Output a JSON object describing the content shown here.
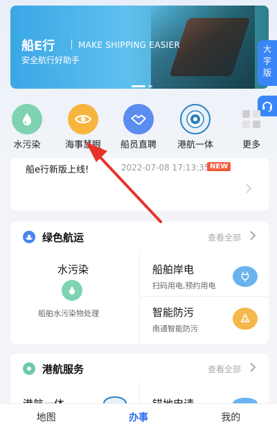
{
  "banner": {
    "title": "船E行",
    "slogan_en": "MAKE SHIPPING EASIER",
    "slogan_cn": "安全航行好助手"
  },
  "side_buttons": {
    "big_text": [
      "大",
      "字",
      "版"
    ]
  },
  "quick_actions": [
    {
      "label": "水污染",
      "icon": "water-drop-icon",
      "color": "#6cc9a6"
    },
    {
      "label": "海事慧眼",
      "icon": "eye-icon",
      "color": "#f7b540"
    },
    {
      "label": "船员直聘",
      "icon": "handshake-icon",
      "color": "#5b8cf0"
    },
    {
      "label": "港航一体",
      "icon": "seal-icon",
      "color": "#2a7fbf"
    },
    {
      "label": "更多",
      "icon": "grid-icon",
      "color": "#cccccc"
    }
  ],
  "news": {
    "title": "船e行新版上线!",
    "date": "2022-07-08 17:13:35",
    "badge": "NEW"
  },
  "green_shipping": {
    "title": "绿色航运",
    "view_all": "查看全部",
    "left": {
      "title": "水污染",
      "sub": "船舶水污染物处理"
    },
    "right_top": {
      "title": "船舶岸电",
      "sub": "扫码用电,预约用电"
    },
    "right_bottom": {
      "title": "智能防污",
      "sub": "南通智能防污"
    }
  },
  "port_service": {
    "title": "港航服务",
    "view_all": "查看全部",
    "left": {
      "title": "港航一体"
    },
    "right": {
      "title": "锚地申请"
    }
  },
  "tabs": [
    {
      "label": "地图",
      "active": false
    },
    {
      "label": "办事",
      "active": true
    },
    {
      "label": "我的",
      "active": false
    }
  ],
  "colors": {
    "accent": "#2b6df0",
    "badge": "#f15a3b",
    "annotation_arrow": "#e8322c"
  }
}
